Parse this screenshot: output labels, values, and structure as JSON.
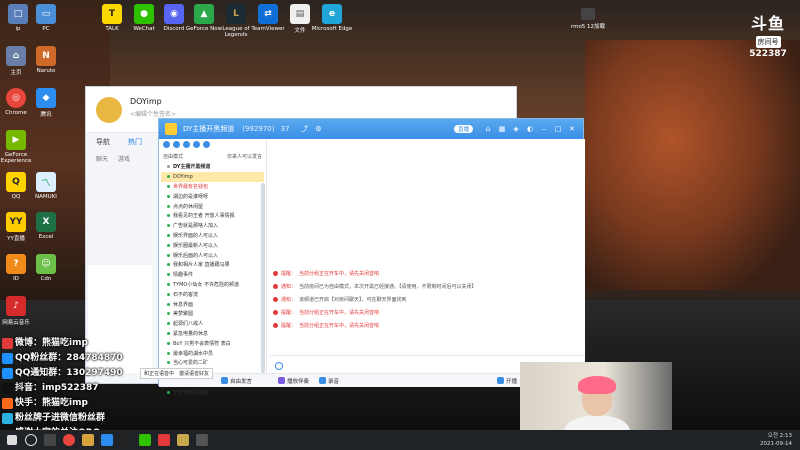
{
  "desktop": {
    "icons_top": [
      "ip",
      "PC",
      "TALK",
      "WeChat",
      "Discord",
      "GeForce Now",
      "League of Legends",
      "TeamViewer",
      "文件",
      "Microsoft Edge"
    ],
    "icons_left": [
      "主页",
      "Naruto",
      "Chrome",
      "腾讯",
      "GeForce Experience",
      "QQ",
      "NAMUKI",
      "YY直播",
      "Excel",
      "ID",
      "Cdn",
      "网易云音乐"
    ],
    "small_icon_label": "rmo5 12加载",
    "colors": {
      "accent": "#3a8ee6",
      "alert": "#e23a3a"
    }
  },
  "brand": {
    "logo": "斗鱼",
    "tag": "房间号",
    "room": "522387"
  },
  "back_window": {
    "name": "DOYimp",
    "signature": "<编辑个性签名>",
    "tabs": [
      "导航",
      "热门",
      "",
      ""
    ],
    "subtabs": [
      "聊天",
      "游戏",
      "",
      ""
    ]
  },
  "chat_window": {
    "title": "DY主播开黑频道",
    "title_id": "(992970)",
    "title_count": "37",
    "pill": "直播",
    "side": {
      "filter_left": "自由模式",
      "filter_right": "仅来人可以发言",
      "rows": [
        {
          "text": "DY主播开黑频道",
          "style": "group"
        },
        {
          "text": "DOYimp",
          "style": "sel"
        },
        {
          "text": "世界最有名钱包",
          "style": "red"
        },
        {
          "text": "湖边的是谁呀呀",
          "style": ""
        },
        {
          "text": "点点的休闲屋",
          "style": ""
        },
        {
          "text": "我看见的王者 开放人事情报",
          "style": ""
        },
        {
          "text": "广告就是那啥人加入",
          "style": ""
        },
        {
          "text": "娱乐界面的人可以入",
          "style": ""
        },
        {
          "text": "娱乐圈最新人可以入",
          "style": ""
        },
        {
          "text": "娱乐后面的人可以入",
          "style": ""
        },
        {
          "text": "我和相片人家 直播跟马果",
          "style": ""
        },
        {
          "text": "情趣事件",
          "style": ""
        },
        {
          "text": "TYMO小仙女 不许危险的频道",
          "style": ""
        },
        {
          "text": "石不的客流",
          "style": ""
        },
        {
          "text": "休息界面",
          "style": ""
        },
        {
          "text": "美梦聚圆",
          "style": ""
        },
        {
          "text": "起源们八戒人",
          "style": ""
        },
        {
          "text": "紧急电量的休息",
          "style": ""
        },
        {
          "text": "BoY 只男不会表情符 表白",
          "style": ""
        },
        {
          "text": "最幸福的湖水中员",
          "style": ""
        },
        {
          "text": "当心可爱的二矿",
          "style": ""
        },
        {
          "text": "lal的新道理",
          "style": ""
        },
        {
          "text": "假期的情况",
          "style": ""
        },
        {
          "text": "王记暂时的东西",
          "style": ""
        }
      ]
    },
    "messages": [
      {
        "label": "提醒：",
        "text": "当前分组正在开车中，请先关闭音响",
        "style": "red"
      },
      {
        "label": "通知：",
        "text": "当前房间已为自由模式，本次开黑已经接通。【请使用，不限制时间后可以关闭】",
        "style": ""
      },
      {
        "label": "通知：",
        "text": "该频道已开启【对房间聊天】，可在聊天界面找到",
        "style": ""
      },
      {
        "label": "提醒：",
        "text": "当前分组正在开车中，请先关闭音响",
        "style": "red"
      },
      {
        "label": "提醒：",
        "text": "当前分组正在开车中，请先关闭音响",
        "style": "red"
      }
    ],
    "bottom_bar": [
      {
        "label": "自由发言",
        "color": "#3a8ee6"
      },
      {
        "label": "播放伴奏",
        "color": "#7a5ae0"
      },
      {
        "label": "录音",
        "color": "#3a8ee6"
      },
      {
        "label": "开播",
        "color": "#3a8ee6"
      }
    ]
  },
  "tip_bar": {
    "left": "和正在语音中",
    "right": "邀请语音好友"
  },
  "overlay": {
    "lines": [
      "微博：熊猫吃imp",
      "QQ粉丝群：284784870",
      "QQ通知群：130297490",
      "抖音：imp522387",
      "快手：熊猫吃imp",
      "粉丝牌子进微信粉丝群",
      "感谢大家的关注ORO"
    ]
  },
  "taskbar": {
    "time": "오전 2:13",
    "date": "2021-09-14"
  }
}
